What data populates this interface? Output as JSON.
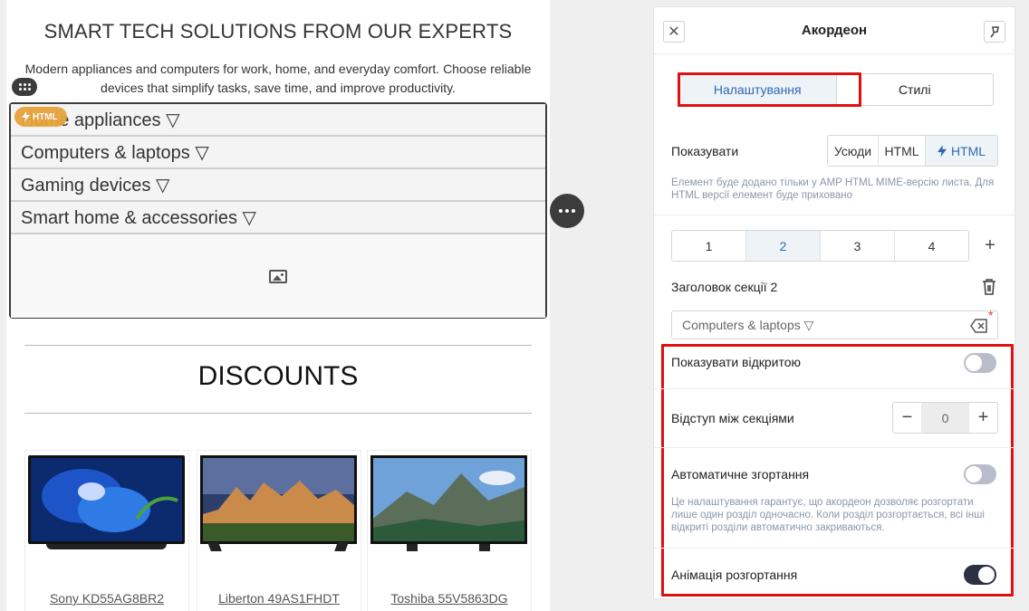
{
  "email": {
    "hero_title": "SMART TECH SOLUTIONS FROM OUR EXPERTS",
    "hero_text": "Modern appliances and computers for work, home, and everyday comfort. Choose reliable devices that simplify tasks, save time, and improve productivity.",
    "html_badge": "HTML",
    "accordion_items": [
      "Home appliances ▽",
      "Computers & laptops ▽",
      "Gaming devices ▽",
      "Smart home & accessories ▽"
    ],
    "discounts_title": "DISCOUNTS",
    "products": [
      {
        "name": "Sony KD55AG8BR2"
      },
      {
        "name": "Liberton 49AS1FHDT"
      },
      {
        "name": "Toshiba 55V5863DG"
      }
    ]
  },
  "panel": {
    "title": "Акордеон",
    "tabs": [
      {
        "label": "Налаштування",
        "active": true
      },
      {
        "label": "Стилі",
        "active": false
      }
    ],
    "show_label": "Показувати",
    "show_options": [
      "Усюди",
      "HTML",
      "HTML"
    ],
    "show_selected": 2,
    "show_hint": "Елемент буде додано тільки у AMP HTML MIME-версію листа. Для HTML версії елемент буде приховано",
    "sections": [
      "1",
      "2",
      "3",
      "4"
    ],
    "section_selected": 1,
    "section_title_label": "Заголовок секції 2",
    "section_title_value": "Computers & laptops ▽",
    "required_mark": "*",
    "show_open_label": "Показувати відкритою",
    "show_open": false,
    "spacing_label": "Відступ між секціями",
    "spacing_value": "0",
    "auto_collapse_label": "Автоматичне згортання",
    "auto_collapse": false,
    "auto_collapse_hint": "Це налаштування гарантує, що акордеон дозволяє розгортати лише один розділ одночасно. Коли розділ розгортається, всі інші відкриті розділи автоматично закриваються.",
    "animation_label": "Анімація розгортання",
    "animation": true
  },
  "colors": {
    "accent_blue": "#2f69b5",
    "highlight_red": "#e01010",
    "badge_orange": "#e8a33b",
    "toggle_on": "#2b3042",
    "toggle_off": "#b9bccb"
  }
}
